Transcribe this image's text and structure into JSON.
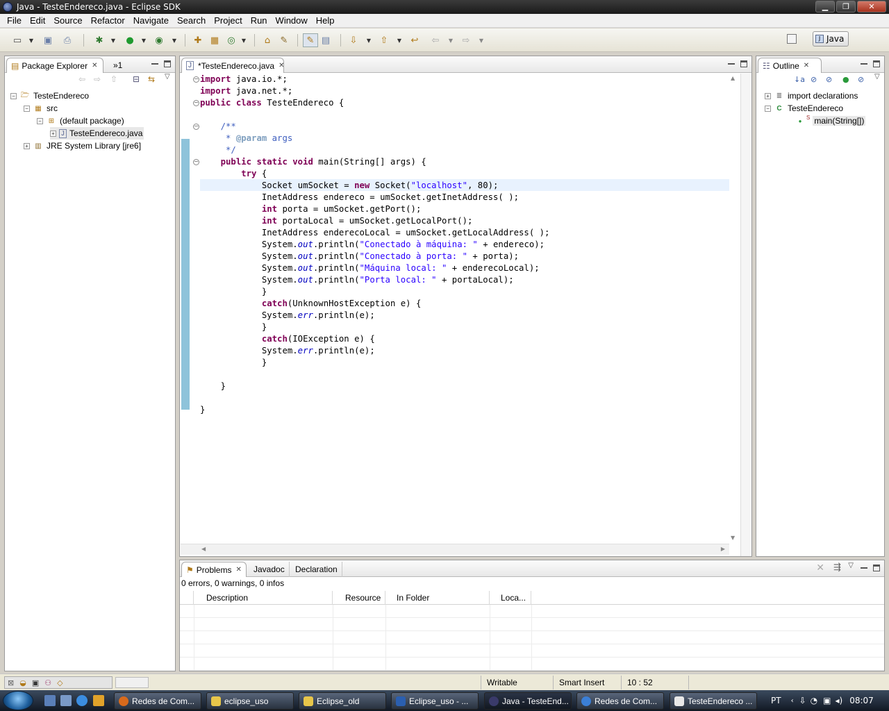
{
  "window": {
    "title": "Java - TesteEndereco.java - Eclipse SDK",
    "min": "▁",
    "max": "❐",
    "close": "✕"
  },
  "menu": [
    "File",
    "Edit",
    "Source",
    "Refactor",
    "Navigate",
    "Search",
    "Project",
    "Run",
    "Window",
    "Help"
  ],
  "perspective": {
    "label": "Java"
  },
  "package_explorer": {
    "tab_label": "Package Explorer",
    "second_tab_label": "»1",
    "tree": [
      {
        "label": "TesteEndereco",
        "expander": "−",
        "icon": "project-icon"
      },
      {
        "label": "src",
        "expander": "−",
        "icon": "source-folder-icon"
      },
      {
        "label": "(default package)",
        "expander": "−",
        "icon": "package-icon"
      },
      {
        "label": "TesteEndereco.java",
        "expander": "+",
        "icon": "java-file-icon"
      },
      {
        "label": "JRE System Library [jre6]",
        "expander": "+",
        "icon": "library-icon"
      }
    ]
  },
  "editor": {
    "tab_label": "*TesteEndereco.java",
    "lines": [
      "import java.io.*;",
      "import java.net.*;",
      "public class TesteEndereco {",
      "",
      "    /**",
      "     * @param args",
      "     */",
      "    public static void main(String[] args) {",
      "        try {",
      "            Socket umSocket = new Socket(\"localhost\", 80);",
      "            InetAddress endereco = umSocket.getInetAddress( );",
      "            int porta = umSocket.getPort();",
      "            int portaLocal = umSocket.getLocalPort();",
      "            InetAddress enderecoLocal = umSocket.getLocalAddress( );",
      "            System.out.println(\"Conectado à máquina: \" + endereco);",
      "            System.out.println(\"Conectado à porta: \" + porta);",
      "            System.out.println(\"Máquina local: \" + enderecoLocal);",
      "            System.out.println(\"Porta local: \" + portaLocal);",
      "            }",
      "            catch(UnknownHostException e) {",
      "            System.err.println(e);",
      "            }",
      "            catch(IOException e) {",
      "            System.err.println(e);",
      "            }",
      "",
      "    }",
      "",
      "}"
    ]
  },
  "outline": {
    "tab_label": "Outline",
    "items": [
      {
        "label": "import declarations"
      },
      {
        "label": "TesteEndereco"
      },
      {
        "label": "main(String[])",
        "modifier": "S"
      }
    ]
  },
  "problems": {
    "tabs": [
      "Problems",
      "Javadoc",
      "Declaration"
    ],
    "summary": "0 errors, 0 warnings, 0 infos",
    "columns": [
      "Description",
      "Resource",
      "In Folder",
      "Loca..."
    ]
  },
  "status": {
    "writable": "Writable",
    "insert_mode": "Smart Insert",
    "position": "10 : 52"
  },
  "taskbar": {
    "tasks": [
      {
        "label": "Redes de Com...",
        "color": "#d86a1c"
      },
      {
        "label": "eclipse_uso",
        "color": "#e8c64a"
      },
      {
        "label": "Eclipse_old",
        "color": "#e8c64a"
      },
      {
        "label": "Eclipse_uso - ...",
        "color": "#2b5fb0"
      },
      {
        "label": "Java - TesteEnd...",
        "color": "#3a3a6a"
      },
      {
        "label": "Redes de Com...",
        "color": "#3b7fd6"
      },
      {
        "label": "TesteEndereco ...",
        "color": "#e8e8e8"
      }
    ],
    "language": "PT",
    "clock": "08:07"
  },
  "colors": {
    "keyword": "#7f0055",
    "string": "#2a00ff",
    "comment": "#3f5fbf",
    "field": "#0000c0",
    "quick_diff": "#8ec3da",
    "current_line": "#e8f2fe"
  }
}
